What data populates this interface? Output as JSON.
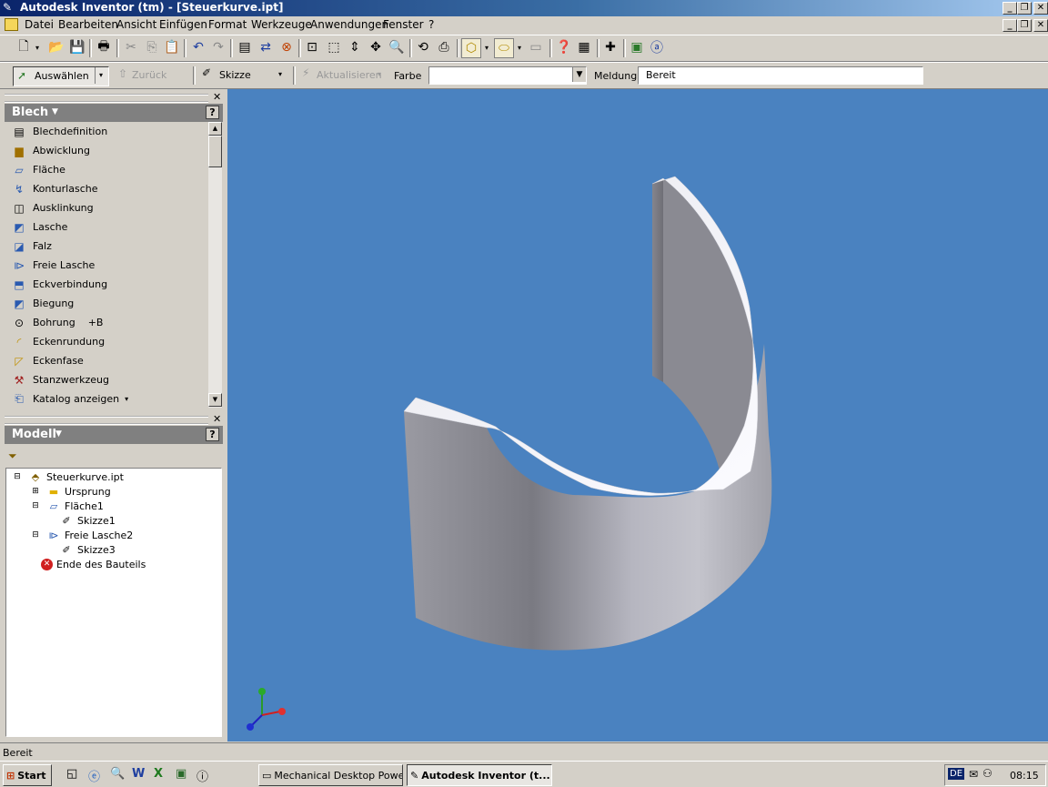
{
  "window": {
    "title": "Autodesk Inventor (tm) - [Steuerkurve.ipt]",
    "buttons": [
      "_",
      "❐",
      "✕"
    ]
  },
  "menubar": {
    "items": [
      "Datei",
      "Bearbeiten",
      "Ansicht",
      "Einfügen",
      "Format",
      "Werkzeuge",
      "Anwendungen",
      "Fenster",
      "?"
    ],
    "mdi_buttons": [
      "_",
      "❐",
      "✕"
    ]
  },
  "command_bar": {
    "select_label": "Auswählen",
    "back_label": "Zurück",
    "sketch_label": "Skizze",
    "update_label": "Aktualisieren",
    "color_label": "Farbe",
    "color_value": "",
    "message_label": "Meldung",
    "message_value": "Bereit"
  },
  "blech_panel": {
    "title": "Blech",
    "help": "?",
    "items": [
      {
        "label": "Blechdefinition",
        "icon": "sheet-definition-icon"
      },
      {
        "label": "Abwicklung",
        "icon": "flat-pattern-icon"
      },
      {
        "label": "Fläche",
        "icon": "face-icon"
      },
      {
        "label": "Konturlasche",
        "icon": "contour-flange-icon"
      },
      {
        "label": "Ausklinkung",
        "icon": "cut-icon"
      },
      {
        "label": "Lasche",
        "icon": "flange-icon"
      },
      {
        "label": "Falz",
        "icon": "hem-icon"
      },
      {
        "label": "Freie Lasche",
        "icon": "free-flange-icon"
      },
      {
        "label": "Eckverbindung",
        "icon": "corner-seam-icon"
      },
      {
        "label": "Biegung",
        "icon": "bend-icon"
      },
      {
        "label": "Bohrung",
        "shortcut": "+B",
        "icon": "hole-icon"
      },
      {
        "label": "Eckenrundung",
        "icon": "corner-round-icon"
      },
      {
        "label": "Eckenfase",
        "icon": "corner-chamfer-icon"
      },
      {
        "label": "Stanzwerkzeug",
        "icon": "punch-tool-icon"
      },
      {
        "label": "Katalog anzeigen",
        "icon": "catalog-icon"
      }
    ]
  },
  "model_panel": {
    "title": "Modell",
    "help": "?",
    "tree": [
      {
        "label": "Steuerkurve.ipt",
        "icon": "part-icon"
      },
      {
        "label": "Ursprung",
        "icon": "folder-icon"
      },
      {
        "label": "Fläche1",
        "icon": "face-icon"
      },
      {
        "label": "Skizze1",
        "icon": "sketch-icon"
      },
      {
        "label": "Freie Lasche2",
        "icon": "free-flange-icon"
      },
      {
        "label": "Skizze3",
        "icon": "sketch-icon"
      },
      {
        "label": "Ende des Bauteils",
        "icon": "end-of-part-icon"
      }
    ]
  },
  "viewport": {
    "background": "#4a82c0"
  },
  "statusbar": {
    "text": "Bereit"
  },
  "taskbar": {
    "start": "Start",
    "tasks": [
      "Mechanical Desktop Powe...",
      "Autodesk Inventor (t..."
    ],
    "lang": "DE",
    "clock": "08:15"
  }
}
